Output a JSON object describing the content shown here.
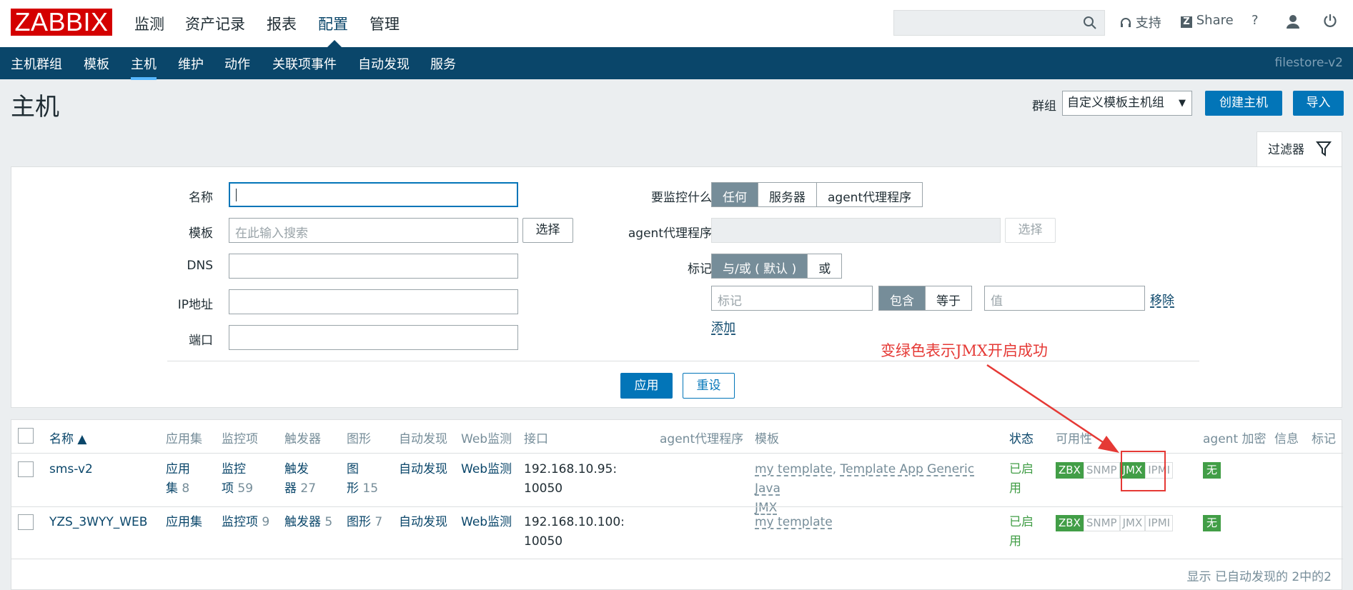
{
  "app": {
    "logo": "ZABBIX"
  },
  "top_menu": [
    {
      "label": "监测"
    },
    {
      "label": "资产记录"
    },
    {
      "label": "报表"
    },
    {
      "label": "配置"
    },
    {
      "label": "管理"
    }
  ],
  "top_right": {
    "support": "支持",
    "share": "Share",
    "help": "?"
  },
  "sub_menu": [
    {
      "label": "主机群组"
    },
    {
      "label": "模板"
    },
    {
      "label": "主机"
    },
    {
      "label": "维护"
    },
    {
      "label": "动作"
    },
    {
      "label": "关联项事件"
    },
    {
      "label": "自动发现"
    },
    {
      "label": "服务"
    }
  ],
  "server_name": "filestore-v2",
  "page": {
    "title": "主机",
    "group_label": "群组",
    "group_value": "自定义模板主机组",
    "create_button": "创建主机",
    "import_button": "导入"
  },
  "filter": {
    "tab_label": "过滤器",
    "name_label": "名称",
    "name_value": "",
    "template_label": "模板",
    "template_placeholder": "在此输入搜索",
    "select_button": "选择",
    "dns_label": "DNS",
    "ip_label": "IP地址",
    "port_label": "端口",
    "monitored_by_label": "要监控什么",
    "monitored_by_options": [
      "任何",
      "服务器",
      "agent代理程序"
    ],
    "proxy_label": "agent代理程序",
    "proxy_select_button": "选择",
    "tags_label": "标记",
    "tags_mode_options": [
      "与/或 ( 默认 )",
      "或"
    ],
    "tag_placeholder": "标记",
    "tag_op_options": [
      "包含",
      "等于"
    ],
    "value_placeholder": "值",
    "remove_link": "移除",
    "add_link": "添加",
    "apply_button": "应用",
    "reset_button": "重设"
  },
  "annotation": "变绿色表示JMX开启成功",
  "table": {
    "headers": {
      "name": "名称 ▲",
      "apps": "应用集",
      "items": "监控项",
      "triggers": "触发器",
      "graphs": "图形",
      "discovery": "自动发现",
      "web": "Web监测",
      "interface": "接口",
      "proxy": "agent代理程序",
      "templates": "模板",
      "status": "状态",
      "availability": "可用性",
      "encryption": "agent 加密",
      "info": "信息",
      "tags": "标记"
    },
    "rows": [
      {
        "name": "sms-v2",
        "apps_l1": "应用",
        "apps_l2": "集",
        "apps_count": "8",
        "items_l1": "监控",
        "items_l2": "项",
        "items_count": "59",
        "triggers_l1": "触发",
        "triggers_l2": "器",
        "triggers_count": "27",
        "graphs_l1": "图",
        "graphs_l2": "形",
        "graphs_count": "15",
        "discovery": "自动发现",
        "web": "Web监测",
        "interface_l1": "192.168.10.95:",
        "interface_l2": "10050",
        "template1": "my template",
        "template_sep": ",",
        "template2a": "Template App Generic Java",
        "template2b": "JMX",
        "status_l1": "已启",
        "status_l2": "用",
        "zbx": "ZBX",
        "snmp": "SNMP",
        "jmx": "JMX",
        "ipmi": "IPMI",
        "encryption": "无"
      },
      {
        "name": "YZS_3WYY_WEB",
        "apps": "应用集",
        "items": "监控项",
        "items_count": "9",
        "triggers": "触发器",
        "triggers_count": "5",
        "graphs": "图形",
        "graphs_count": "7",
        "discovery": "自动发现",
        "web": "Web监测",
        "interface_l1": "192.168.10.100:",
        "interface_l2": "10050",
        "template1": "my template",
        "status_l1": "已启",
        "status_l2": "用",
        "zbx": "ZBX",
        "snmp": "SNMP",
        "jmx": "JMX",
        "ipmi": "IPMI",
        "encryption": "无"
      }
    ],
    "footer": "显示 已自动发现的 2中的2"
  },
  "colors": {
    "brand": "#d40000",
    "nav": "#0a466a",
    "primary": "#0275b8",
    "ok": "#429e47",
    "annotation": "#e53935"
  }
}
